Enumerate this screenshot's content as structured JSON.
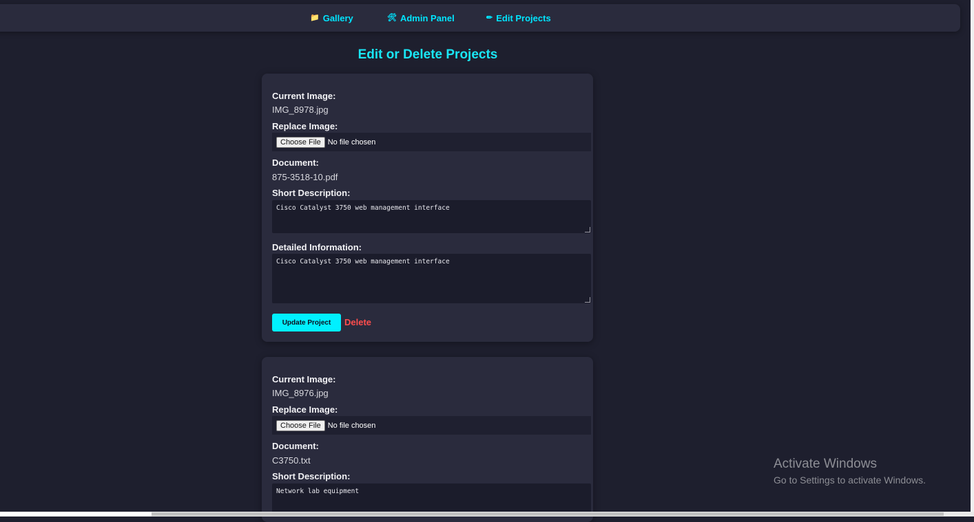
{
  "nav": {
    "items": [
      {
        "icon": "folder-icon",
        "glyph": "📁",
        "label": "Gallery"
      },
      {
        "icon": "tools-icon",
        "glyph": "🛠",
        "label": "Admin Panel"
      },
      {
        "icon": "pencil-icon",
        "glyph": "✏",
        "label": "Edit Projects"
      }
    ]
  },
  "page_title": "Edit or Delete Projects",
  "labels": {
    "current_image": "Current Image:",
    "replace_image": "Replace Image:",
    "document": "Document:",
    "short_description": "Short Description:",
    "detailed_information": "Detailed Information:",
    "choose_file": "Choose File",
    "no_file": "No file chosen",
    "update": "Update Project",
    "delete": "Delete"
  },
  "projects": [
    {
      "image": "IMG_8978.jpg",
      "document": "875-3518-10.pdf",
      "short_description": "Cisco Catalyst 3750 web management interface",
      "detailed_information": "Cisco Catalyst 3750 web management interface"
    },
    {
      "image": "IMG_8976.jpg",
      "document": "C3750.txt",
      "short_description": "Network lab equipment"
    }
  ],
  "watermark": {
    "line1": "Activate Windows",
    "line2": "Go to Settings to activate Windows."
  },
  "colors": {
    "accent": "#00e5ff",
    "background": "#1e1f2e",
    "card": "#2a2b3d",
    "danger": "#ff4d4d"
  }
}
